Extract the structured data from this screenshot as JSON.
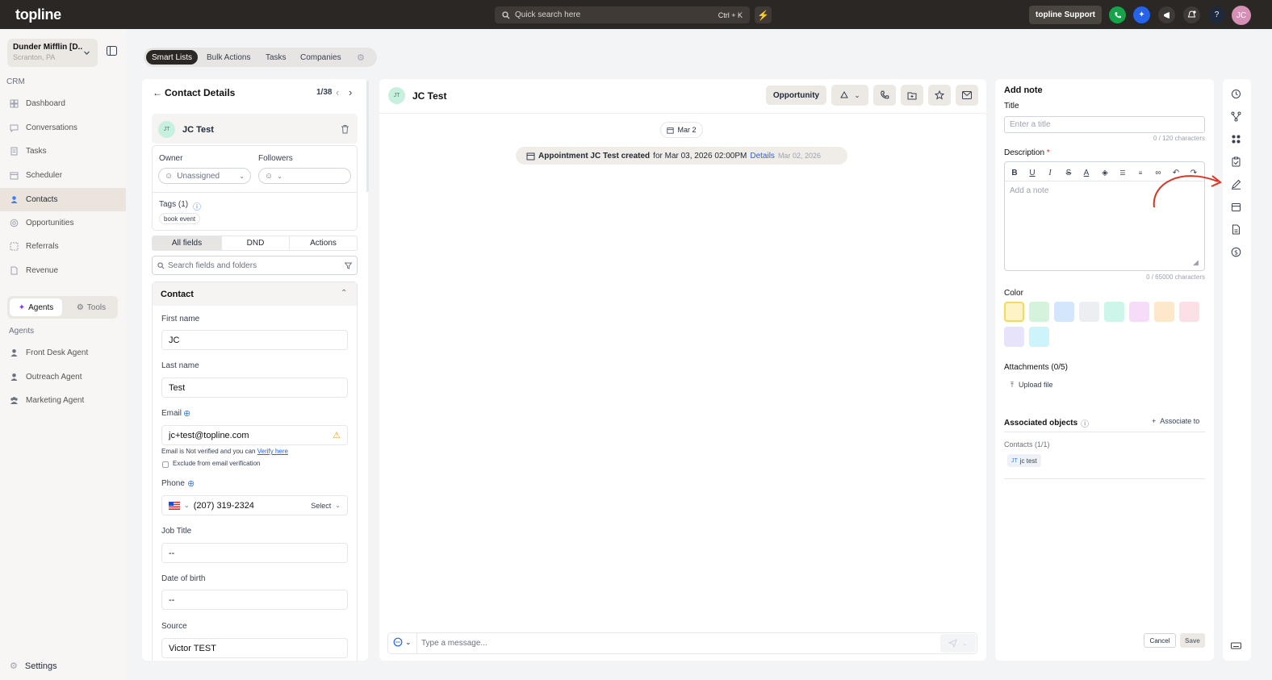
{
  "app": {
    "logo": "topline"
  },
  "topbar": {
    "search_placeholder": "Quick search here",
    "shortcut": "Ctrl + K",
    "support_label": "topline Support",
    "avatar": "JC"
  },
  "account": {
    "name": "Dunder Mifflin [D...",
    "location": "Scranton, PA"
  },
  "sidebar": {
    "section": "CRM",
    "items": [
      {
        "label": "Dashboard",
        "icon": "dashboard-icon"
      },
      {
        "label": "Conversations",
        "icon": "chat-icon"
      },
      {
        "label": "Tasks",
        "icon": "tasks-icon"
      },
      {
        "label": "Scheduler",
        "icon": "calendar-icon"
      },
      {
        "label": "Contacts",
        "icon": "user-icon",
        "active": true
      },
      {
        "label": "Opportunities",
        "icon": "target-icon"
      },
      {
        "label": "Referrals",
        "icon": "referral-icon"
      },
      {
        "label": "Revenue",
        "icon": "document-icon"
      }
    ],
    "toggle": {
      "agents": "Agents",
      "tools": "Tools"
    },
    "agents_heading": "Agents",
    "agents": [
      "Front Desk Agent",
      "Outreach Agent",
      "Marketing Agent"
    ],
    "settings": "Settings"
  },
  "tabs": [
    "Smart Lists",
    "Bulk Actions",
    "Tasks",
    "Companies"
  ],
  "contact_panel": {
    "title": "Contact Details",
    "pager": "1/38",
    "contact_initials": "JT",
    "contact_name": "JC Test",
    "owner_label": "Owner",
    "owner_value": "Unassigned",
    "followers_label": "Followers",
    "tags_label": "Tags (1)",
    "tag": "book event",
    "subtabs": [
      "All fields",
      "DND",
      "Actions"
    ],
    "search_placeholder": "Search fields and folders",
    "section": "Contact",
    "first_name_label": "First name",
    "first_name": "JC",
    "last_name_label": "Last name",
    "last_name": "Test",
    "email_label": "Email",
    "email": "jc+test@topline.com",
    "email_note": "Email is Not verified and you can",
    "verify_link": "Verify here",
    "exclude_label": "Exclude from email verification",
    "phone_label": "Phone",
    "phone": "(207) 319-2324",
    "phone_select": "Select",
    "job_title_label": "Job Title",
    "job_title": "--",
    "dob_label": "Date of birth",
    "dob": "--",
    "source_label": "Source",
    "source": "Victor TEST"
  },
  "conversation": {
    "initials": "JT",
    "name": "JC Test",
    "opportunity_btn": "Opportunity",
    "date_chip": "Mar 2",
    "event_bold": "Appointment JC Test created",
    "event_rest": "for Mar 03, 2026 02:00PM",
    "event_link": "Details",
    "event_date": "Mar 02, 2026",
    "message_placeholder": "Type a message..."
  },
  "note": {
    "heading": "Add note",
    "title_label": "Title",
    "title_placeholder": "Enter a title",
    "title_count": "0 / 120 characters",
    "desc_label": "Description",
    "required_mark": "*",
    "desc_placeholder": "Add a note",
    "desc_count": "0 / 65000 characters",
    "color_label": "Color",
    "colors": [
      "#fdf3c4",
      "#d4f2dc",
      "#d3e6fb",
      "#eceef1",
      "#cdf5ea",
      "#f6dcf8",
      "#fde8cc",
      "#fbe0e6",
      "#e6e3fb",
      "#cdf4fb"
    ],
    "attachments_label": "Attachments (0/5)",
    "upload_label": "Upload file",
    "assoc_label": "Associated objects",
    "associate_to": "Associate to",
    "contacts_count": "Contacts (1/1)",
    "assoc_chip_initials": "JT",
    "assoc_chip_name": "jc test",
    "cancel": "Cancel",
    "save": "Save"
  }
}
